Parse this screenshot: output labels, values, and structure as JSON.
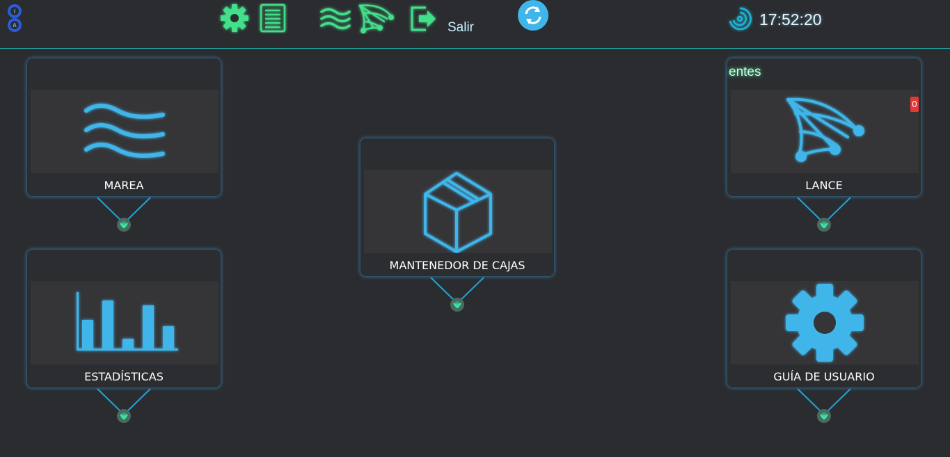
{
  "header": {
    "logo": "IA",
    "salir_label": "Salir",
    "clock": "17:52:20",
    "icons": [
      "settings-gear-icon",
      "document-list-icon",
      "waves-icon",
      "fishing-net-icon",
      "exit-icon",
      "refresh-icon",
      "spinner-icon"
    ]
  },
  "tiles": [
    {
      "label": "MAREA",
      "icon": "waves-icon"
    },
    {
      "label": "MANTENEDOR DE CAJAS",
      "icon": "box-icon"
    },
    {
      "label": "LANCE",
      "icon": "fishing-net-icon",
      "badge": "0",
      "marquee": "entes"
    },
    {
      "label": "ESTADÍSTICAS",
      "icon": "bar-chart-icon"
    },
    {
      "label": "GUÍA DE USUARIO",
      "icon": "gear-icon"
    }
  ],
  "colors": {
    "accent": "#3fb5ea",
    "green": "#43e08a",
    "background": "#2b2c30",
    "card_image_bg": "#353537",
    "badge": "#e53935"
  }
}
